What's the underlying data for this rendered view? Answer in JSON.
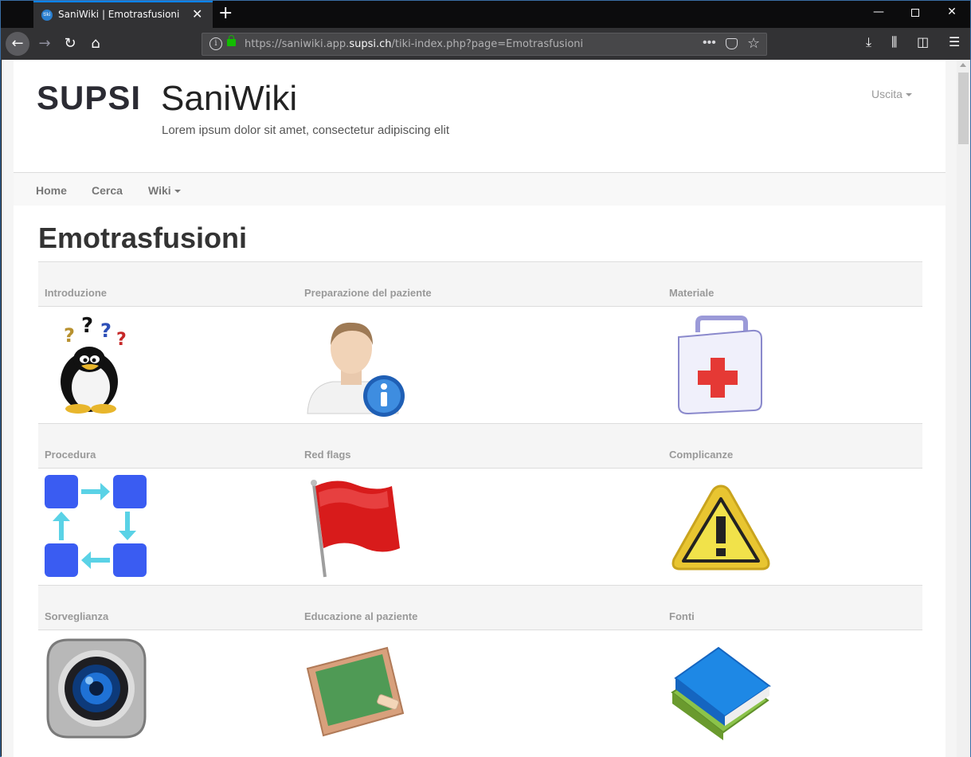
{
  "browser": {
    "tab_title": "SaniWiki | Emotrasfusioni",
    "favicon_text": "tiki",
    "tab_close": "✕",
    "new_tab": "+",
    "url_prefix": "https://saniwiki.app.",
    "url_domain": "supsi.ch",
    "url_path": "/tiki-index.php?page=Emotrasfusioni",
    "url_more": "•••"
  },
  "header": {
    "logo": "SUPSI",
    "site_title": "SaniWiki",
    "site_subtitle": "Lorem ipsum dolor sit amet, consectetur adipiscing elit",
    "user_menu": "Uscita"
  },
  "nav": {
    "home": "Home",
    "cerca": "Cerca",
    "wiki": "Wiki"
  },
  "page": {
    "heading": "Emotrasfusioni"
  },
  "sections": [
    {
      "title": "Introduzione",
      "icon": "penguin-question-icon"
    },
    {
      "title": "Preparazione del paziente",
      "icon": "user-info-icon"
    },
    {
      "title": "Materiale",
      "icon": "first-aid-kit-icon"
    },
    {
      "title": "Procedura",
      "icon": "process-flow-icon"
    },
    {
      "title": "Red flags",
      "icon": "red-flag-icon"
    },
    {
      "title": "Complicanze",
      "icon": "warning-icon"
    },
    {
      "title": "Sorveglianza",
      "icon": "camera-icon"
    },
    {
      "title": "Educazione al paziente",
      "icon": "chalkboard-icon"
    },
    {
      "title": "Fonti",
      "icon": "books-icon"
    }
  ]
}
